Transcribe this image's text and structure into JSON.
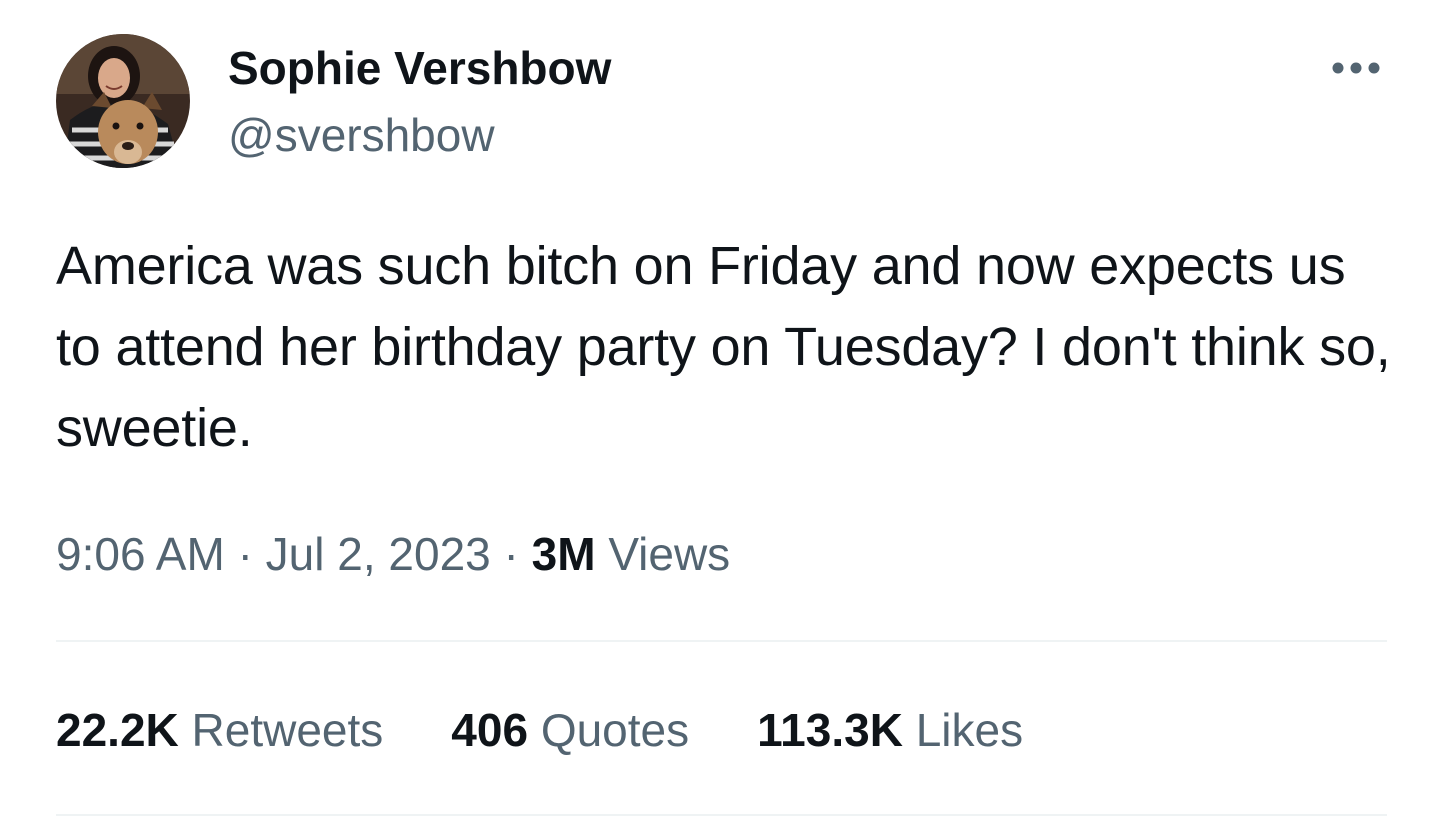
{
  "author": {
    "display_name": "Sophie Vershbow",
    "handle": "@svershbow"
  },
  "more_icon": "more-horizontal-icon",
  "tweet": {
    "text": "America was such bitch on Friday and now expects us to attend her birthday party on Tuesday? I don't think so, sweetie."
  },
  "meta": {
    "time": "9:06 AM",
    "separator": "·",
    "date": "Jul 2, 2023",
    "views_count": "3M",
    "views_label": "Views"
  },
  "stats": {
    "retweets_count": "22.2K",
    "retweets_label": "Retweets",
    "quotes_count": "406",
    "quotes_label": "Quotes",
    "likes_count": "113.3K",
    "likes_label": "Likes"
  },
  "colors": {
    "text_primary": "#0f1419",
    "text_secondary": "#536471",
    "divider": "#eff3f4"
  }
}
